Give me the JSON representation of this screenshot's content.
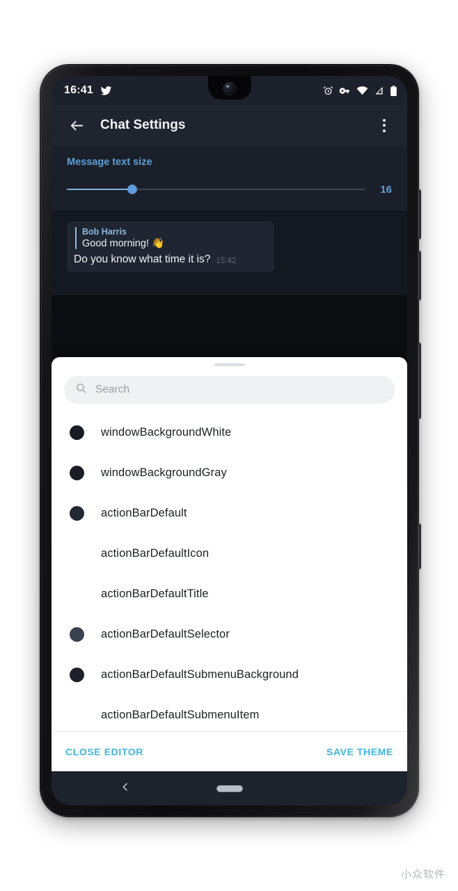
{
  "statusbar": {
    "time": "16:41",
    "app_icon": "twitter-icon",
    "icons": [
      "alarm-icon",
      "vpn-key-icon",
      "wifi-icon",
      "cell-signal-icon",
      "battery-icon"
    ]
  },
  "actionbar": {
    "back_icon": "back-arrow-icon",
    "title": "Chat Settings",
    "overflow_icon": "more-vertical-icon"
  },
  "text_size": {
    "label": "Message text size",
    "value": "16",
    "percent": 22,
    "accent": "#5aa0d6"
  },
  "chat_preview": {
    "reply": {
      "name": "Bob Harris",
      "text": "Good morning! 👋"
    },
    "message": "Do you know what time it is?",
    "time": "15:42"
  },
  "sheet": {
    "handle": "drag-handle",
    "search": {
      "icon": "search-icon",
      "placeholder": "Search",
      "value": ""
    },
    "items": [
      {
        "label": "windowBackgroundWhite",
        "color": "#181b24",
        "has_swatch": true
      },
      {
        "label": "windowBackgroundGray",
        "color": "#1b1e27",
        "has_swatch": true
      },
      {
        "label": "actionBarDefault",
        "color": "#232834",
        "has_swatch": true
      },
      {
        "label": "actionBarDefaultIcon",
        "color": "#ffffff",
        "has_swatch": false
      },
      {
        "label": "actionBarDefaultTitle",
        "color": "#ffffff",
        "has_swatch": false
      },
      {
        "label": "actionBarDefaultSelector",
        "color": "#39414f",
        "has_swatch": true
      },
      {
        "label": "actionBarDefaultSubmenuBackground",
        "color": "#1d2029",
        "has_swatch": true
      },
      {
        "label": "actionBarDefaultSubmenuItem",
        "color": "#ffffff",
        "has_swatch": false
      }
    ],
    "close_label": "CLOSE EDITOR",
    "save_label": "SAVE THEME",
    "action_color": "#3fb6e0"
  },
  "navbar": {
    "back_icon": "nav-back-icon",
    "home_pill": "nav-home-pill"
  },
  "watermark": "小众软件"
}
